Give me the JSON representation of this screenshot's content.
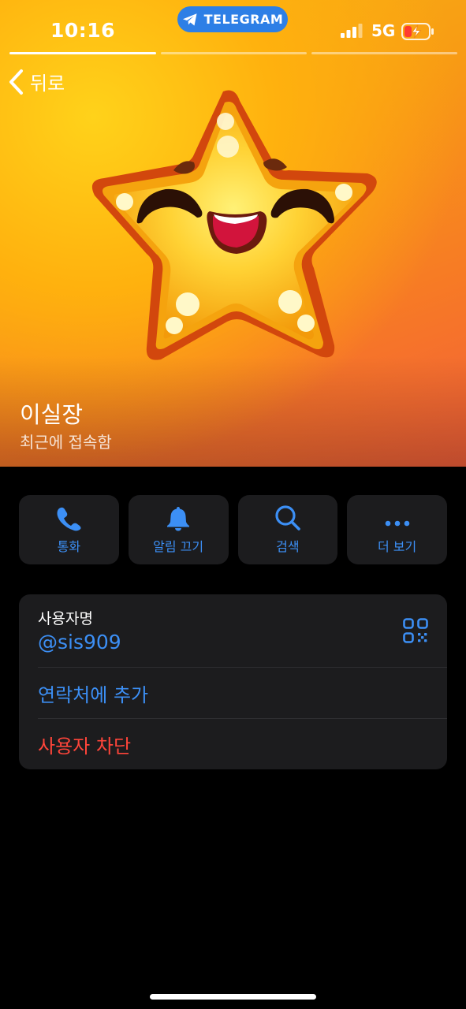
{
  "status_bar": {
    "time": "10:16",
    "app_pill": "TELEGRAM",
    "network": "5G"
  },
  "nav": {
    "back_label": "뒤로"
  },
  "story_progress": {
    "segments": 3,
    "active_segment": 1
  },
  "profile": {
    "name": "이실장",
    "status": "최근에 접속함"
  },
  "actions": [
    {
      "label": "통화",
      "icon": "phone-icon"
    },
    {
      "label": "알림 끄기",
      "icon": "bell-icon"
    },
    {
      "label": "검색",
      "icon": "search-icon"
    },
    {
      "label": "더 보기",
      "icon": "more-icon"
    }
  ],
  "info": {
    "username_label": "사용자명",
    "username_value": "@sis909",
    "add_contact": "연락처에 추가",
    "block_user": "사용자 차단"
  },
  "colors": {
    "accent": "#3c8ff5",
    "destructive": "#ff453a",
    "card": "#1c1c1e",
    "pill": "#2d7fe6"
  }
}
